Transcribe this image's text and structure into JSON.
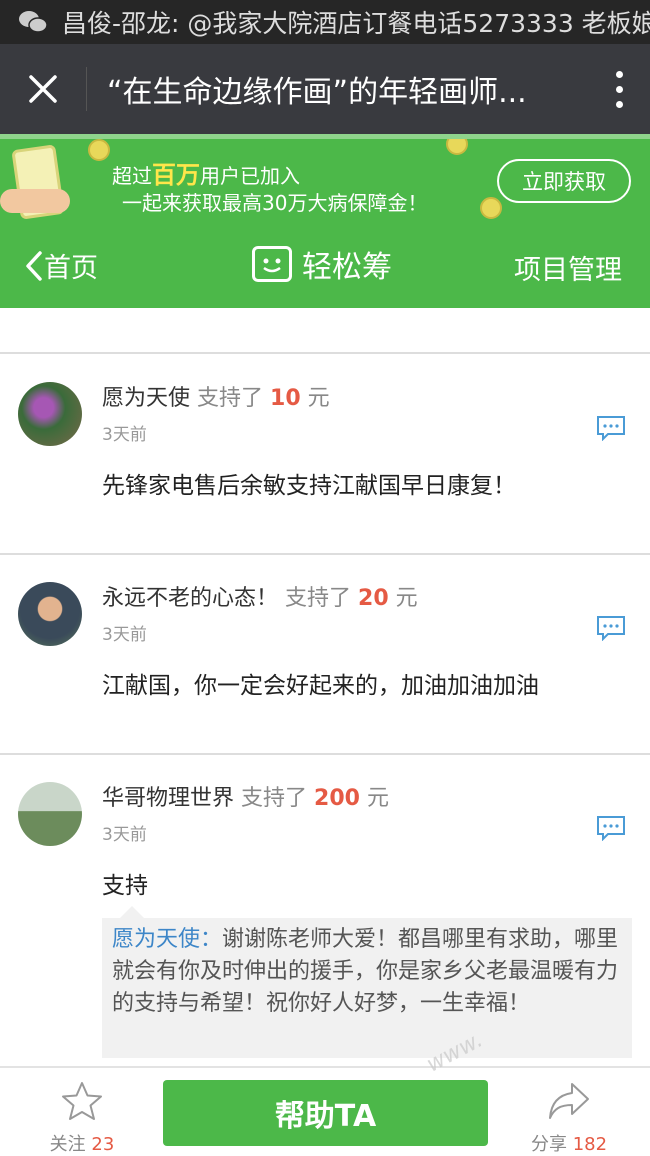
{
  "status_bar": {
    "notification": "昌俊-邵龙: @我家大院酒店订餐电话5273333 老板娘"
  },
  "title_bar": {
    "title": "“在生命边缘作画”的年轻画师..."
  },
  "banner": {
    "line1_prefix": "超过",
    "line1_highlight": "百万",
    "line1_suffix": "用户已加入",
    "line2": "一起来获取最高30万大病保障金！",
    "cta": "立即获取"
  },
  "nav": {
    "back_label": "首页",
    "brand": "轻松筹",
    "manage_label": "项目管理"
  },
  "supporters": [
    {
      "name": "愿为天使",
      "supported": "支持了",
      "amount": "10",
      "unit": "元",
      "time": "3天前",
      "message": "先锋家电售后余敏支持江献国早日康复！"
    },
    {
      "name": "永远不老的心态！",
      "supported": "支持了",
      "amount": "20",
      "unit": "元",
      "time": "3天前",
      "message": "江献国，你一定会好起来的，加油加油加油"
    },
    {
      "name": "华哥物理世界",
      "supported": "支持了",
      "amount": "200",
      "unit": "元",
      "time": "3天前",
      "message": "支持"
    }
  ],
  "reply": {
    "author": "愿为天使：",
    "text": "谢谢陈老师大爱！都昌哪里有求助，哪里就会有你及时伸出的援手，你是家乡父老最温暖有力的支持与希望！祝你好人好梦，一生幸福！"
  },
  "bottom_bar": {
    "follow_label": "关注",
    "follow_count": "23",
    "help_label": "帮助TA",
    "share_label": "分享",
    "share_count": "182"
  },
  "watermark": "www.",
  "colors": {
    "brand_green": "#4cb849",
    "amount_red": "#e55a44",
    "link_blue": "#3d86c8"
  }
}
